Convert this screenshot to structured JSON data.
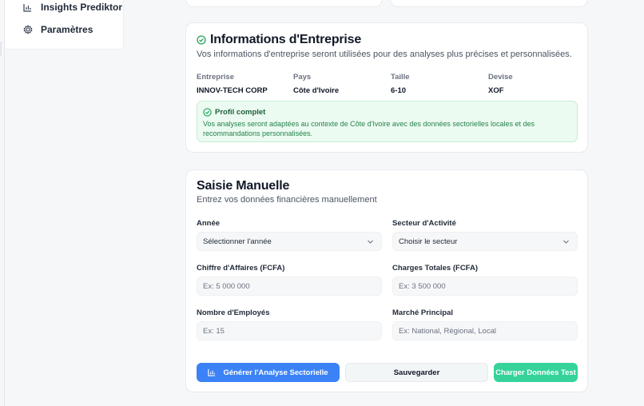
{
  "sidebar": {
    "items": [
      {
        "label": "Insights Prediktor",
        "icon": "bar-chart-icon"
      },
      {
        "label": "Paramètres",
        "icon": "gear-icon"
      }
    ]
  },
  "company_info": {
    "title": "Informations d'Entreprise",
    "subtitle": "Vos informations d'entreprise seront utilisées pour des analyses plus précises et personnalisées.",
    "fields": [
      {
        "label": "Entreprise",
        "value": "INNOV-TECH CORP"
      },
      {
        "label": "Pays",
        "value": "Côte d'Ivoire"
      },
      {
        "label": "Taille",
        "value": "6-10"
      },
      {
        "label": "Devise",
        "value": "XOF"
      }
    ],
    "profile": {
      "heading": "Profil complet",
      "text": "Vos analyses seront adaptées au contexte de Côte d'Ivoire avec des données sectorielles locales et des recommandations personnalisées."
    }
  },
  "manual_entry": {
    "title": "Saisie Manuelle",
    "subtitle": "Entrez vos données financières manuellement",
    "year": {
      "label": "Année",
      "value": "Sélectionner l'année"
    },
    "sector": {
      "label": "Secteur d'Activité",
      "value": "Choisir le secteur"
    },
    "revenue": {
      "label": "Chiffre d'Affaires (FCFA)",
      "placeholder": "Ex: 5 000 000"
    },
    "charges": {
      "label": "Charges Totales (FCFA)",
      "placeholder": "Ex: 3 500 000"
    },
    "employees": {
      "label": "Nombre d'Employés",
      "placeholder": "Ex: 15"
    },
    "market": {
      "label": "Marché Principal",
      "placeholder": "Ex: National, Régional, Local"
    },
    "buttons": {
      "generate": "Générer l'Analyse Sectorielle",
      "save": "Sauvegarder",
      "load_test": "Charger Données Test"
    }
  },
  "colors": {
    "primary": "#3b82f6",
    "success": "#35d39a",
    "success_bg": "#ecfbf1",
    "success_text": "#23824a"
  }
}
